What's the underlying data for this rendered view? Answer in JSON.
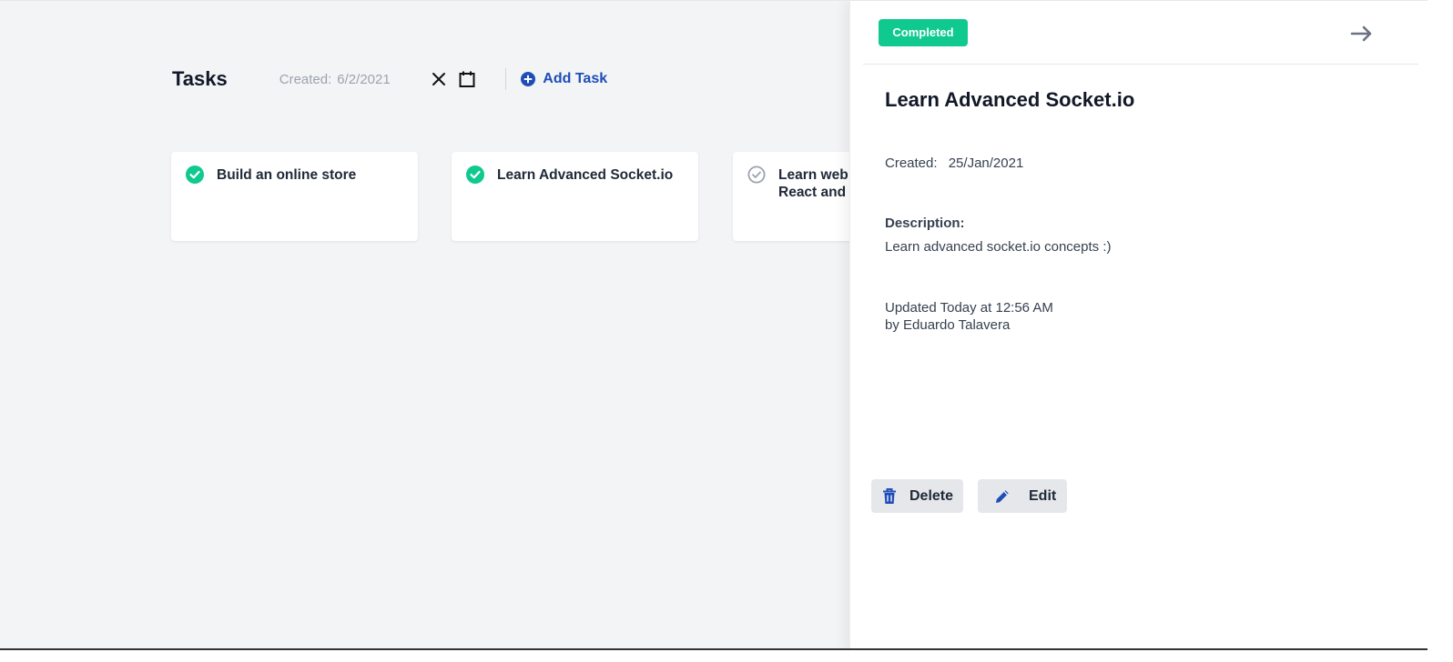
{
  "toolbar": {
    "title": "Tasks",
    "date_label": "Created:",
    "date_value": "6/2/2021",
    "clear_icon": "close-icon",
    "calendar_icon": "calendar-icon",
    "add_task_label": "Add Task",
    "add_task_icon": "plus-circle-icon"
  },
  "tasks": [
    {
      "title": "Build an online store",
      "status": "completed",
      "icon": "check-circle-icon"
    },
    {
      "title": "Learn Advanced Socket.io",
      "status": "completed",
      "icon": "check-circle-icon"
    },
    {
      "title": "Learn web",
      "title_line2": "React and I",
      "status": "pending",
      "icon": "check-circle-outline-icon"
    }
  ],
  "detail": {
    "status_badge": "Completed",
    "close_icon": "arrow-right-icon",
    "title": "Learn Advanced Socket.io",
    "created_label": "Created:",
    "created_value": "25/Jan/2021",
    "description_label": "Description:",
    "description": "Learn advanced socket.io concepts :)",
    "updated_line1": "Updated Today at 12:56 AM",
    "updated_line2": "by Eduardo Talavera",
    "delete_label": "Delete",
    "delete_icon": "trash-icon",
    "edit_label": "Edit",
    "edit_icon": "pencil-icon"
  },
  "colors": {
    "accent": "#1e4db7",
    "success": "#10c98f",
    "background": "#f3f4f6",
    "muted_icon": "#9ca3af"
  }
}
